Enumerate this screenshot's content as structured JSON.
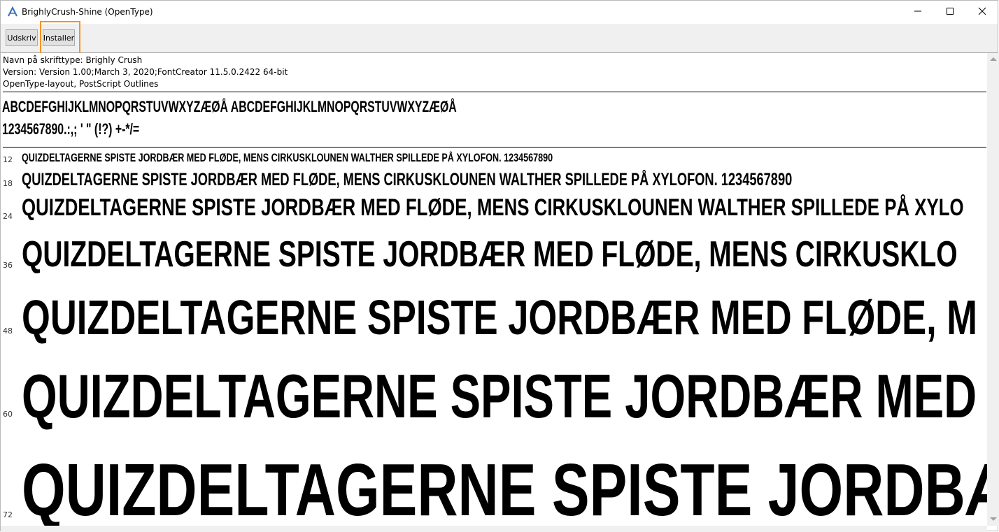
{
  "window": {
    "title": "BrighlyCrush-Shine (OpenType)"
  },
  "toolbar": {
    "print_label": "Udskriv",
    "install_label": "Installer"
  },
  "font_info": {
    "name_line": "Navn på skrifttype: Brighly Crush",
    "version_line": "Version: Version 1.00;March 3, 2020;FontCreator 11.5.0.2422 64-bit",
    "layout_line": "OpenType-layout, PostScript Outlines"
  },
  "charset": {
    "letters": "ABCDEFGHIJKLMNOPQRSTUVWXYZÆØÅ ABCDEFGHIJKLMNOPQRSTUVWXYZÆØÅ",
    "digits": "1234567890.:,; ' \" (!?) +-*/="
  },
  "samples": [
    {
      "size": "12",
      "text": "QUIZDELTAGERNE SPISTE JORDBÆR MED FLØDE, MENS CIRKUSKLOUNEN WALTHER SPILLEDE PÅ XYLOFON. 1234567890"
    },
    {
      "size": "18",
      "text": "QUIZDELTAGERNE SPISTE JORDBÆR MED FLØDE, MENS CIRKUSKLOUNEN WALTHER SPILLEDE PÅ XYLOFON. 1234567890"
    },
    {
      "size": "24",
      "text": "QUIZDELTAGERNE SPISTE JORDBÆR MED FLØDE, MENS CIRKUSKLOUNEN WALTHER SPILLEDE PÅ XYLO"
    },
    {
      "size": "36",
      "text": "QUIZDELTAGERNE SPISTE JORDBÆR MED FLØDE, MENS CIRKUSKLO"
    },
    {
      "size": "48",
      "text": "QUIZDELTAGERNE SPISTE JORDBÆR MED FLØDE, M"
    },
    {
      "size": "60",
      "text": "QUIZDELTAGERNE SPISTE JORDBÆR MED"
    },
    {
      "size": "72",
      "text": "QUIZDELTAGERNE SPISTE JORDBÆ"
    }
  ],
  "icons": {
    "app": "font-file-icon",
    "minimize": "minimize-icon",
    "maximize": "maximize-icon",
    "close": "close-icon"
  }
}
